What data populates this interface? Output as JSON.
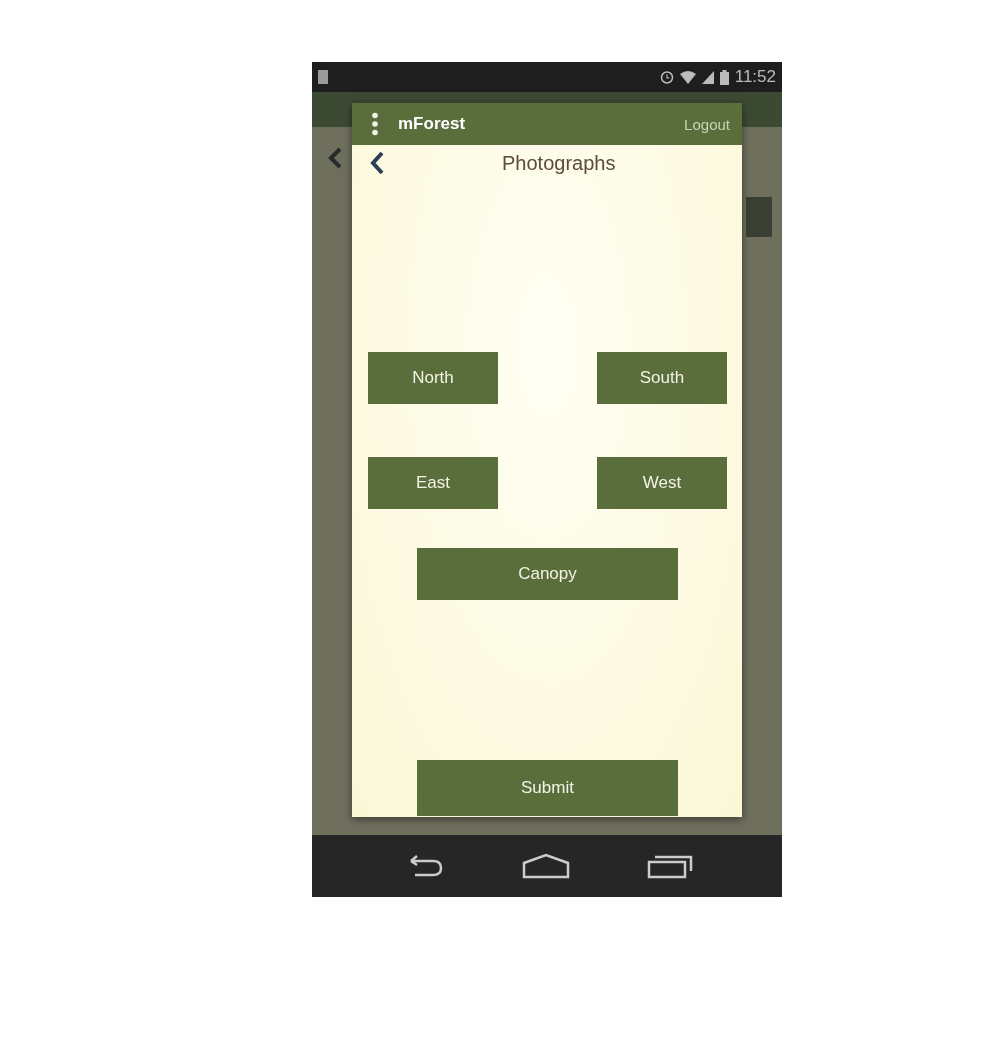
{
  "status_bar": {
    "time": "11:52"
  },
  "dialog": {
    "app_title": "mForest",
    "action": "Logout",
    "screen_title": "Photographs",
    "direction_buttons": [
      {
        "label": "North"
      },
      {
        "label": "South"
      },
      {
        "label": "East"
      },
      {
        "label": "West"
      }
    ],
    "canopy_button": "Canopy",
    "submit_button": "Submit"
  }
}
